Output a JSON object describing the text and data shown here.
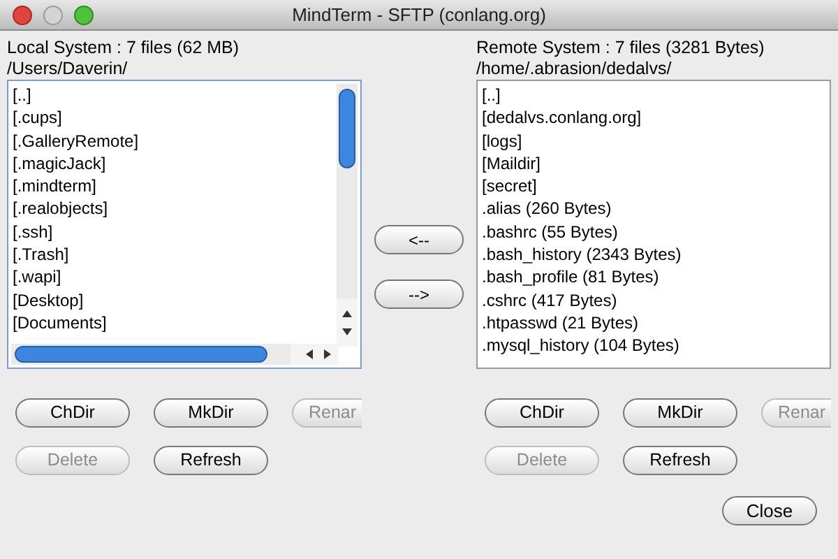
{
  "window": {
    "title": "MindTerm - SFTP (conlang.org)"
  },
  "local": {
    "summary": "Local System : 7 files (62 MB)",
    "path": "/Users/Daverin/",
    "files": [
      "[..]",
      "[.cups]",
      "[.GalleryRemote]",
      "[.magicJack]",
      "[.mindterm]",
      "[.realobjects]",
      "[.ssh]",
      "[.Trash]",
      "[.wapi]",
      "[Desktop]",
      "[Documents]"
    ],
    "buttons": [
      {
        "label": "ChDir",
        "disabled": false
      },
      {
        "label": "MkDir",
        "disabled": false
      },
      {
        "label": "Renar",
        "disabled": true
      },
      {
        "label": "Delete",
        "disabled": true
      },
      {
        "label": "Refresh",
        "disabled": false
      }
    ]
  },
  "transfer_buttons": [
    "<--",
    "-->"
  ],
  "remote": {
    "summary": "Remote System : 7 files (3281 Bytes)",
    "path": "/home/.abrasion/dedalvs/",
    "files": [
      "[..]",
      "[dedalvs.conlang.org]",
      "[logs]",
      "[Maildir]",
      "[secret]",
      ".alias (260 Bytes)",
      ".bashrc (55 Bytes)",
      ".bash_history (2343 Bytes)",
      ".bash_profile (81 Bytes)",
      ".cshrc (417 Bytes)",
      ".htpasswd (21 Bytes)",
      ".mysql_history (104 Bytes)"
    ],
    "buttons": [
      {
        "label": "ChDir",
        "disabled": false
      },
      {
        "label": "MkDir",
        "disabled": false
      },
      {
        "label": "Renar",
        "disabled": true
      },
      {
        "label": "Delete",
        "disabled": true
      },
      {
        "label": "Refresh",
        "disabled": false
      }
    ]
  },
  "close_button": "Close"
}
